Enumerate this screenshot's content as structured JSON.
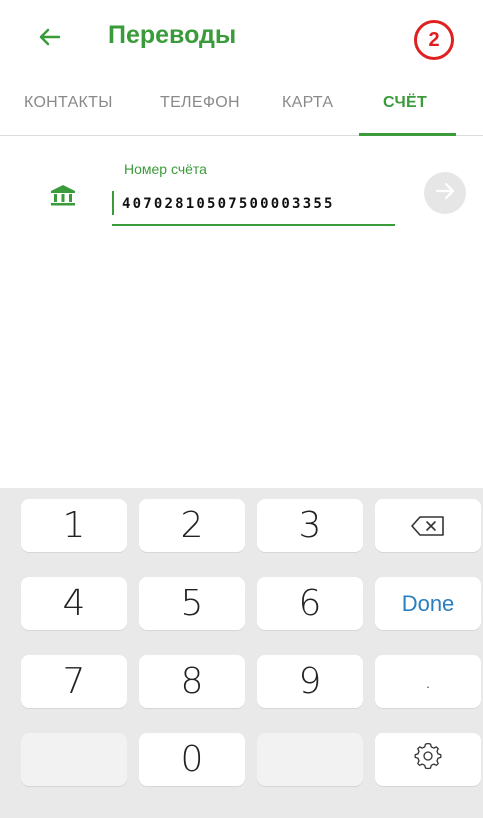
{
  "header": {
    "back_icon": "arrow-left-icon",
    "title": "Переводы",
    "step_badge": "2"
  },
  "tabs": [
    {
      "label": "КОНТАКТЫ",
      "active": false
    },
    {
      "label": "ТЕЛЕФОН",
      "active": false
    },
    {
      "label": "КАРТА",
      "active": false
    },
    {
      "label": "СЧЁТ",
      "active": true
    }
  ],
  "form": {
    "icon": "bank-icon",
    "label": "Номер счёта",
    "value": "40702810507500003355",
    "submit_icon": "arrow-right-icon"
  },
  "keyboard": {
    "keys": [
      "1",
      "2",
      "3",
      "4",
      "5",
      "6",
      "7",
      "8",
      "9",
      "0",
      "."
    ],
    "done_label": "Done",
    "backspace_icon": "backspace-icon",
    "settings_icon": "gear-icon"
  },
  "colors": {
    "accent": "#3a9b3a",
    "badge": "#e02020",
    "done": "#2a7fc1"
  }
}
